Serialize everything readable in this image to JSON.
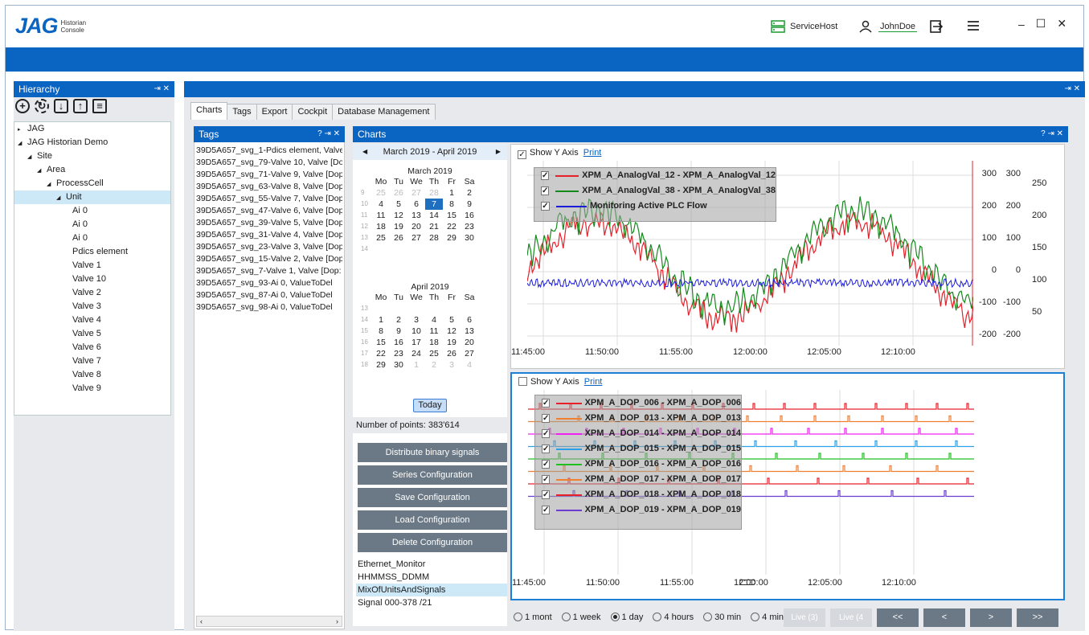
{
  "app": {
    "logo": "JAG",
    "logo_sub1": "Historian",
    "logo_sub2": "Console",
    "service": "ServiceHost",
    "user": "JohnDoe"
  },
  "hierarchy": {
    "title": "Hierarchy",
    "pin": "⇥ ✕",
    "tree": [
      {
        "label": "JAG",
        "depth": 0,
        "arrow": "▸"
      },
      {
        "label": "JAG Historian Demo",
        "depth": 0,
        "arrow": "◢"
      },
      {
        "label": "Site",
        "depth": 1,
        "arrow": "◢"
      },
      {
        "label": "Area",
        "depth": 2,
        "arrow": "◢"
      },
      {
        "label": "ProcessCell",
        "depth": 3,
        "arrow": "◢"
      },
      {
        "label": "Unit",
        "depth": 4,
        "arrow": "◢",
        "selected": true
      },
      {
        "label": "Ai 0",
        "depth": 5
      },
      {
        "label": "Ai 0",
        "depth": 5
      },
      {
        "label": "Ai 0",
        "depth": 5
      },
      {
        "label": "Pdics element",
        "depth": 5
      },
      {
        "label": "Valve 1",
        "depth": 5
      },
      {
        "label": "Valve 10",
        "depth": 5
      },
      {
        "label": "Valve 2",
        "depth": 5
      },
      {
        "label": "Valve 3",
        "depth": 5
      },
      {
        "label": "Valve 4",
        "depth": 5
      },
      {
        "label": "Valve 5",
        "depth": 5
      },
      {
        "label": "Valve 6",
        "depth": 5
      },
      {
        "label": "Valve 7",
        "depth": 5
      },
      {
        "label": "Valve 8",
        "depth": 5
      },
      {
        "label": "Valve 9",
        "depth": 5
      }
    ]
  },
  "main": {
    "pin": "⇥ ✕",
    "tabs": [
      "Charts",
      "Tags",
      "Export",
      "Cockpit",
      "Database Management"
    ]
  },
  "tags": {
    "title": "Tags",
    "ctl": "? ⇥ ✕",
    "items": [
      "39D5A657_svg_1-Pdics element, Valve",
      "39D5A657_svg_79-Valve 10, Valve [Dop",
      "39D5A657_svg_71-Valve 9, Valve [Dop:",
      "39D5A657_svg_63-Valve 8, Valve [Dop:",
      "39D5A657_svg_55-Valve 7, Valve [Dop:",
      "39D5A657_svg_47-Valve 6, Valve [Dop:",
      "39D5A657_svg_39-Valve 5, Valve [Dop:",
      "39D5A657_svg_31-Valve 4, Valve [Dop:",
      "39D5A657_svg_23-Valve 3, Valve [Dop:",
      "39D5A657_svg_15-Valve 2, Valve [Dop:",
      "39D5A657_svg_7-Valve 1, Valve [Dop:",
      "39D5A657_svg_93-Ai 0, ValueToDel",
      "39D5A657_svg_87-Ai 0, ValueToDel",
      "39D5A657_svg_98-Ai 0, ValueToDel"
    ]
  },
  "charts": {
    "title": "Charts",
    "ctl": "? ⇥ ✕",
    "calendar": {
      "range": "March 2019 - April 2019",
      "days": [
        "Mo",
        "Tu",
        "We",
        "Th",
        "Fr",
        "Sa"
      ],
      "march": {
        "title": "March 2019",
        "rows": [
          [
            "9",
            "25",
            "26",
            "27",
            "28",
            "1",
            "2"
          ],
          [
            "10",
            "4",
            "5",
            "6",
            "7",
            "8",
            "9"
          ],
          [
            "11",
            "11",
            "12",
            "13",
            "14",
            "15",
            "16"
          ],
          [
            "12",
            "18",
            "19",
            "20",
            "21",
            "22",
            "23"
          ],
          [
            "13",
            "25",
            "26",
            "27",
            "28",
            "29",
            "30"
          ],
          [
            "14",
            "",
            "",
            "",
            "",
            "",
            ""
          ]
        ]
      },
      "april": {
        "title": "April 2019",
        "rows": [
          [
            "13",
            "",
            "",
            "",
            "",
            "",
            ""
          ],
          [
            "14",
            "1",
            "2",
            "3",
            "4",
            "5",
            "6"
          ],
          [
            "15",
            "8",
            "9",
            "10",
            "11",
            "12",
            "13"
          ],
          [
            "16",
            "15",
            "16",
            "17",
            "18",
            "19",
            "20"
          ],
          [
            "17",
            "22",
            "23",
            "24",
            "25",
            "26",
            "27"
          ],
          [
            "18",
            "29",
            "30",
            "1",
            "2",
            "3",
            "4"
          ]
        ]
      },
      "today": "Today"
    },
    "points": "Number of points: 383'614",
    "buttons": [
      "Distribute binary signals",
      "Series Configuration",
      "Save Configuration",
      "Load Configuration",
      "Delete Configuration"
    ],
    "configs": [
      "Ethernet_Monitor",
      "HHMMSS_DDMM",
      "MixOfUnitsAndSignals",
      "Signal 000-378 /21"
    ],
    "show_y": "Show Y Axis",
    "print": "Print",
    "chart1_legend": [
      {
        "name": "XPM_A_AnalogVal_12 - XPM_A_AnalogVal_12",
        "color": "#e8202a"
      },
      {
        "name": "XPM_A_AnalogVal_38 - XPM_A_AnalogVal_38",
        "color": "#138a1b"
      },
      {
        "name": "Monitoring Active PLC Flow",
        "color": "#1c1cdb"
      }
    ],
    "chart2_legend": [
      {
        "name": "XPM_A_DOP_006 - XPM_A_DOP_006",
        "color": "#e8202a"
      },
      {
        "name": "XPM_A_DOP_013 - XPM_A_DOP_013",
        "color": "#f08030"
      },
      {
        "name": "XPM_A_DOP_014 - XPM_A_DOP_014",
        "color": "#f020f0"
      },
      {
        "name": "XPM_A_DOP_015 - XPM_A_DOP_015",
        "color": "#2aa0e8"
      },
      {
        "name": "XPM_A_DOP_016 - XPM_A_DOP_016",
        "color": "#20c020"
      },
      {
        "name": "XPM_A_DOP_017 - XPM_A_DOP_017",
        "color": "#f08030"
      },
      {
        "name": "XPM_A_DOP_018 - XPM_A_DOP_018",
        "color": "#e8202a"
      },
      {
        "name": "XPM_A_DOP_019 - XPM_A_DOP_019",
        "color": "#6a3cd0"
      }
    ],
    "xticks": [
      "11:45:00",
      "11:50:00",
      "11:55:00",
      "12:00:00",
      "12:05:00",
      "12:10:00"
    ],
    "yaxes": {
      "red": [
        "300",
        "200",
        "100",
        "0",
        "-100",
        "-200"
      ],
      "green": [
        "300",
        "200",
        "100",
        "0",
        "-100",
        "-200"
      ],
      "blue": [
        "250",
        "200",
        "150",
        "100",
        "50"
      ]
    },
    "ranges": [
      "1 mont",
      "1 week",
      "1 day",
      "4 hours",
      "30 min",
      "4 min"
    ],
    "live": [
      "Live (3)",
      "Live (4"
    ],
    "nav": [
      "<<",
      "<",
      ">",
      ">>"
    ]
  }
}
